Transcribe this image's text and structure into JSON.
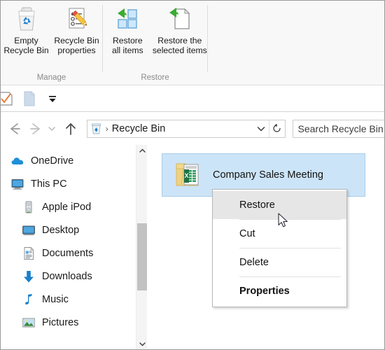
{
  "ribbon": {
    "groups": [
      {
        "name": "Manage",
        "label": "Manage",
        "buttons": [
          {
            "id": "empty-recycle-bin",
            "label": "Empty\nRecycle Bin",
            "icon": "recycle-bin-icon"
          },
          {
            "id": "recycle-bin-properties",
            "label": "Recycle Bin\nproperties",
            "icon": "document-pencil-icon"
          }
        ]
      },
      {
        "name": "Restore",
        "label": "Restore",
        "buttons": [
          {
            "id": "restore-all-items",
            "label": "Restore\nall items",
            "icon": "restore-all-icon"
          },
          {
            "id": "restore-selected-items",
            "label": "Restore the\nselected items",
            "icon": "restore-selected-icon"
          }
        ]
      }
    ]
  },
  "quick_access": {
    "items": [
      {
        "id": "qa-checkmark",
        "icon": "checkmark-document-icon"
      },
      {
        "id": "qa-folder",
        "icon": "blue-page-icon"
      },
      {
        "id": "qa-dropdown",
        "icon": "chevron-down-icon"
      }
    ]
  },
  "address_bar": {
    "back_icon": "arrow-left-icon",
    "forward_icon": "arrow-right-icon",
    "recent_icon": "chevron-down-icon",
    "up_icon": "arrow-up-icon",
    "path_icon": "recycle-bin-small-icon",
    "path_separator": "›",
    "path_text": "Recycle Bin",
    "path_chevron_icon": "chevron-down-icon",
    "refresh_icon": "refresh-icon",
    "search_placeholder": "Search Recycle Bin"
  },
  "nav_pane": {
    "items": [
      {
        "id": "onedrive",
        "label": "OneDrive",
        "icon": "cloud-icon",
        "indent": false
      },
      {
        "id": "this-pc",
        "label": "This PC",
        "icon": "monitor-icon",
        "indent": false
      },
      {
        "id": "apple-ipod",
        "label": "Apple iPod",
        "icon": "ipod-icon",
        "indent": true
      },
      {
        "id": "desktop",
        "label": "Desktop",
        "icon": "desktop-icon",
        "indent": true
      },
      {
        "id": "documents",
        "label": "Documents",
        "icon": "documents-icon",
        "indent": true
      },
      {
        "id": "downloads",
        "label": "Downloads",
        "icon": "download-arrow-icon",
        "indent": true
      },
      {
        "id": "music",
        "label": "Music",
        "icon": "music-note-icon",
        "indent": true
      },
      {
        "id": "pictures",
        "label": "Pictures",
        "icon": "picture-icon",
        "indent": true
      }
    ],
    "scrollbar": {
      "up_icon": "chevron-up-icon",
      "down_icon": "chevron-down-icon"
    }
  },
  "content": {
    "files": [
      {
        "id": "company-sales-meeting",
        "name": "Company Sales Meeting",
        "icon": "excel-folder-icon",
        "selected": true
      }
    ]
  },
  "context_menu": {
    "items": [
      {
        "id": "restore",
        "label": "Restore",
        "highlighted": true,
        "bold": false
      },
      {
        "id": "cut",
        "label": "Cut",
        "highlighted": false,
        "bold": false
      },
      {
        "id": "delete",
        "label": "Delete",
        "highlighted": false,
        "bold": false
      },
      {
        "id": "properties",
        "label": "Properties",
        "highlighted": false,
        "bold": true
      }
    ]
  },
  "cursor": {
    "icon": "arrow-pointer-icon"
  },
  "colors": {
    "selection_fill": "#cce4f7",
    "selection_border": "#a8cdeb",
    "menu_highlight": "#e6e6e6",
    "accent_blue": "#0078d7",
    "ribbon_bg": "#f8f8f8",
    "group_label": "#8a8a8a",
    "scroll_thumb": "#c2c2c2"
  }
}
